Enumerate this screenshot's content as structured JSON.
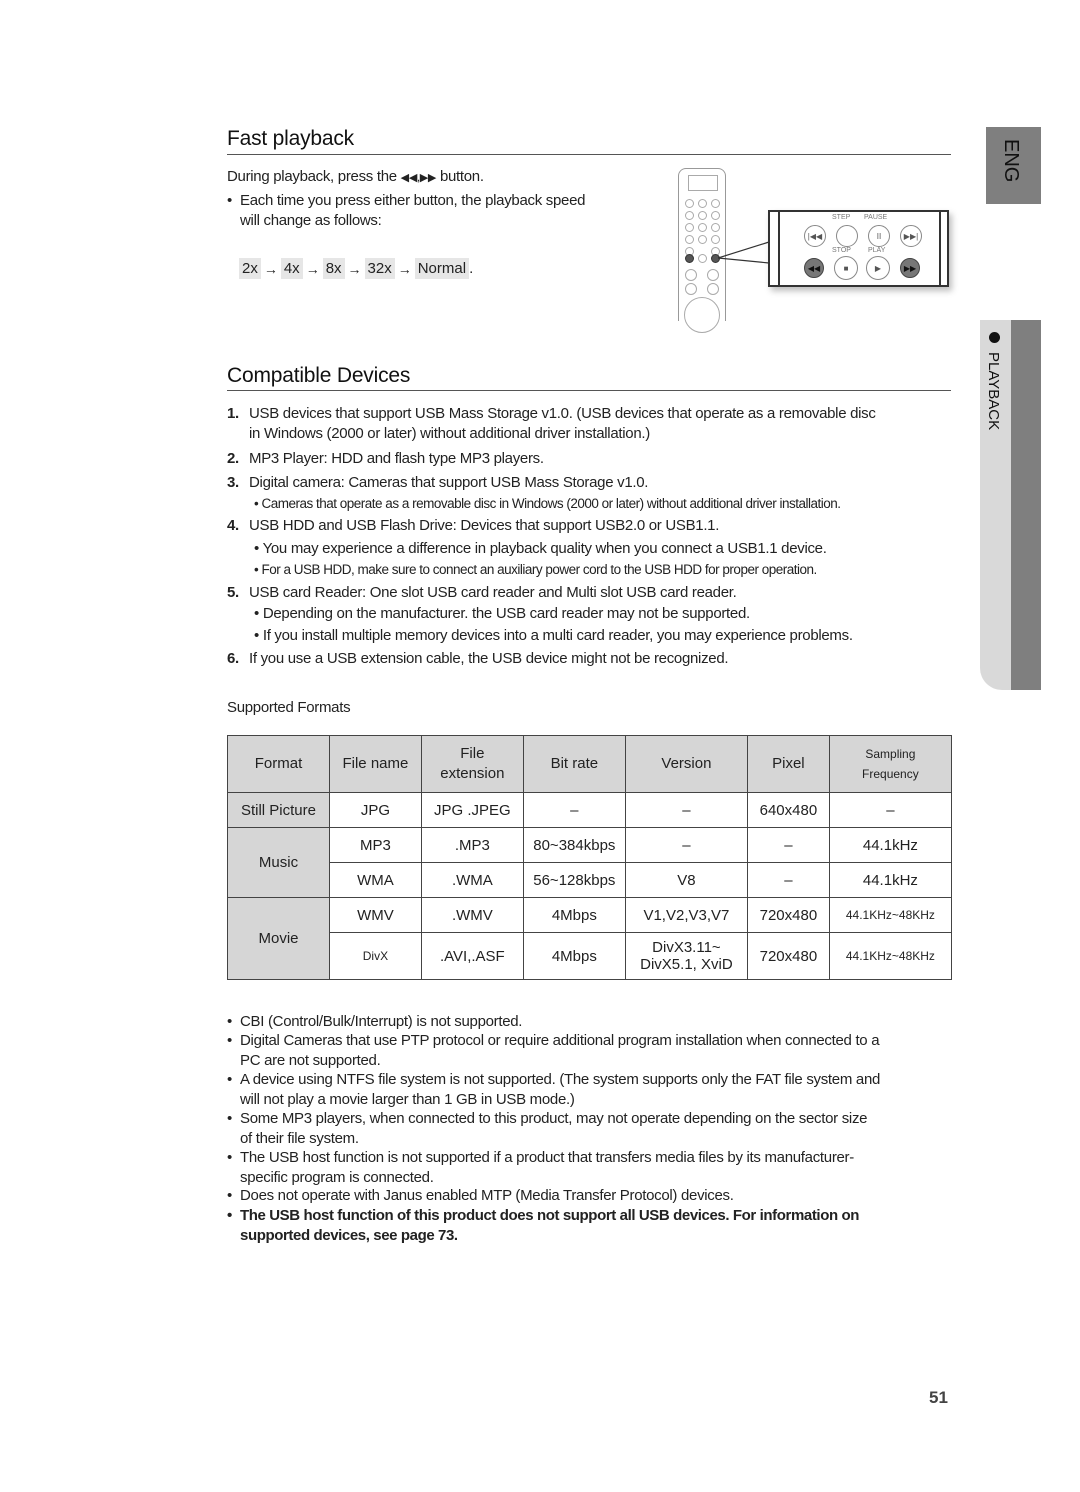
{
  "side_tabs": {
    "language": "ENG",
    "chapter": "PLAYBACK"
  },
  "fast_playback": {
    "title": "Fast playback",
    "instruction_pre": "During playback, press the ",
    "instruction_buttons": "◀◀,▶▶",
    "instruction_post": " button.",
    "bullet_line1": "Each time you press either button, the playback speed",
    "bullet_line2": "will change as follows:",
    "speeds": [
      "2x",
      "4x",
      "8x",
      "32x",
      "Normal"
    ],
    "speeds_end": ".",
    "remote_callout": {
      "labels": {
        "step": "STEP",
        "pause": "PAUSE",
        "stop": "STOP",
        "play": "PLAY"
      },
      "buttons": [
        "skip-back",
        "step",
        "pause",
        "skip-forward",
        "rewind",
        "stop",
        "play",
        "fast-forward"
      ]
    }
  },
  "compatible_devices": {
    "title": "Compatible Devices",
    "items": [
      {
        "num": "1.",
        "lines": [
          "USB devices that support USB Mass Storage v1.0. (USB devices that operate as a removable disc",
          "in Windows (2000 or later) without additional driver installation.)"
        ],
        "bullets": []
      },
      {
        "num": "2.",
        "lines": [
          "MP3 Player: HDD and flash type MP3 players."
        ],
        "bullets": []
      },
      {
        "num": "3.",
        "lines": [
          "Digital camera: Cameras that support USB Mass Storage v1.0."
        ],
        "bullets": [
          "Cameras that operate as a removable disc in Windows (2000 or later) without additional driver installation."
        ]
      },
      {
        "num": "4.",
        "lines": [
          "USB HDD and USB Flash Drive: Devices that support USB2.0 or USB1.1."
        ],
        "bullets": [
          "You may experience a difference in playback quality when you connect a USB1.1 device.",
          "For a USB HDD, make sure to connect an auxiliary power cord to the USB HDD for proper operation."
        ]
      },
      {
        "num": "5.",
        "lines": [
          "USB card Reader: One slot USB card reader and Multi slot USB card reader."
        ],
        "bullets": [
          "Depending on the manufacturer. the USB card reader may not be supported.",
          "If you install multiple memory devices into a multi card reader, you may experience problems."
        ]
      },
      {
        "num": "6.",
        "lines": [
          "If you use a USB extension cable, the USB device might not be recognized."
        ],
        "bullets": []
      }
    ]
  },
  "supported_formats": {
    "title": "Supported Formats",
    "headers": [
      "Format",
      "File name",
      "File\nextension",
      "Bit rate",
      "Version",
      "Pixel",
      "Sampling\nFrequency"
    ],
    "groups": [
      {
        "format": "Still Picture",
        "rows": [
          [
            "JPG",
            "JPG  .JPEG",
            "–",
            "–",
            "640x480",
            "–"
          ]
        ]
      },
      {
        "format": "Music",
        "rows": [
          [
            "MP3",
            ".MP3",
            "80~384kbps",
            "–",
            "–",
            "44.1kHz"
          ],
          [
            "WMA",
            ".WMA",
            "56~128kbps",
            "V8",
            "–",
            "44.1kHz"
          ]
        ]
      },
      {
        "format": "Movie",
        "rows": [
          [
            "WMV",
            ".WMV",
            "4Mbps",
            "V1,V2,V3,V7",
            "720x480",
            "44.1KHz~48KHz"
          ],
          [
            "DivX",
            ".AVI,.ASF",
            "4Mbps",
            "DivX3.11~\nDivX5.1, XviD",
            "720x480",
            "44.1KHz~48KHz"
          ]
        ]
      }
    ]
  },
  "notes": [
    {
      "lines": [
        "CBI (Control/Bulk/Interrupt) is not supported."
      ],
      "bold": false
    },
    {
      "lines": [
        "Digital Cameras that use PTP protocol or require additional program installation when connected to a",
        "PC are not supported."
      ],
      "bold": false
    },
    {
      "lines": [
        "A device using NTFS file system is not supported. (The system supports only the FAT file system and",
        "will not play a movie larger than 1 GB in USB mode.)"
      ],
      "bold": false
    },
    {
      "lines": [
        "Some MP3 players, when connected to this product, may not operate depending on the sector size",
        "of their file system."
      ],
      "bold": false
    },
    {
      "lines": [
        "The USB host function is not supported if a product that transfers media files by its manufacturer-",
        "specific program is connected."
      ],
      "bold": false
    },
    {
      "lines": [
        "Does not operate with Janus enabled MTP (Media Transfer Protocol) devices."
      ],
      "bold": false
    },
    {
      "lines": [
        "The USB host function of this product does not support all USB devices. For information on",
        "supported devices, see page 73."
      ],
      "bold": true
    }
  ],
  "page_number": "51"
}
